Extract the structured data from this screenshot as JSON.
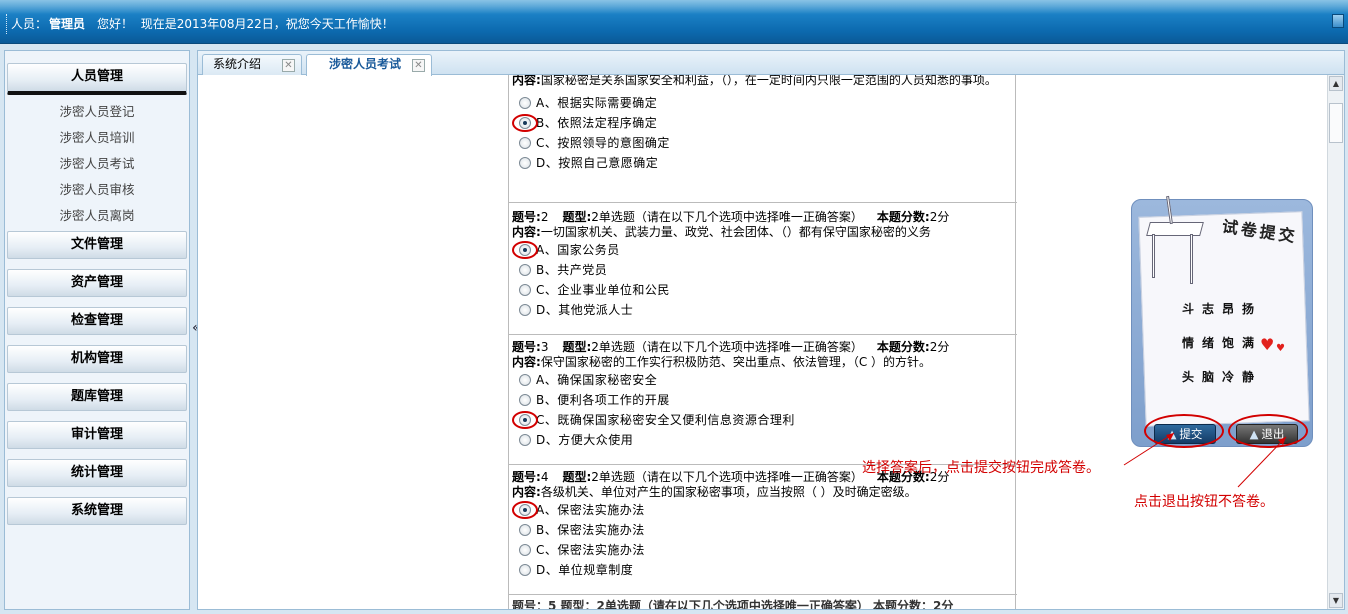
{
  "header": {
    "user_prefix": "人员：",
    "user_name": "管理员",
    "hello": "您好！",
    "date_text": "现在是2013年08月22日，祝您今天工作愉快！"
  },
  "sidebar": {
    "active_menu": "人员管理",
    "sub_items": [
      "涉密人员登记",
      "涉密人员培训",
      "涉密人员考试",
      "涉密人员审核",
      "涉密人员离岗"
    ],
    "menus": [
      "文件管理",
      "资产管理",
      "检查管理",
      "机构管理",
      "题库管理",
      "审计管理",
      "统计管理",
      "系统管理"
    ],
    "collapse_glyph": "«"
  },
  "tabs": [
    {
      "label": "系统介绍",
      "active": false
    },
    {
      "label": "涉密人员考试",
      "active": true
    }
  ],
  "questions": [
    {
      "content_label": "内容:",
      "content": "国家秘密是关系国家安全和利益，（），在一定时间内只限一定范围的人员知悉的事项。",
      "options": [
        "A、根据实际需要确定",
        "B、依照法定程序确定",
        "C、按照领导的意图确定",
        "D、按照自己意愿确定"
      ],
      "selected": 1
    },
    {
      "no_label": "题号:",
      "no": "2",
      "type_label": "题型:",
      "type": "2单选题（请在以下几个选项中选择唯一正确答案）",
      "score_label": "本题分数:",
      "score": "2分",
      "content_label": "内容:",
      "content": "一切国家机关、武装力量、政党、社会团体、（）都有保守国家秘密的义务",
      "options": [
        "A、国家公务员",
        "B、共产党员",
        "C、企业事业单位和公民",
        "D、其他党派人士"
      ],
      "selected": 0
    },
    {
      "no_label": "题号:",
      "no": "3",
      "type_label": "题型:",
      "type": "2单选题（请在以下几个选项中选择唯一正确答案）",
      "score_label": "本题分数:",
      "score": "2分",
      "content_label": "内容:",
      "content": "保守国家秘密的工作实行积极防范、突出重点、依法管理，（C ）的方针。",
      "options": [
        "A、确保国家秘密安全",
        "B、便利各项工作的开展",
        "C、既确保国家秘密安全又便利信息资源合理利",
        "D、方便大众使用"
      ],
      "selected": 2
    },
    {
      "no_label": "题号:",
      "no": "4",
      "type_label": "题型:",
      "type": "2单选题（请在以下几个选项中选择唯一正确答案）",
      "score_label": "本题分数:",
      "score": "2分",
      "content_label": "内容:",
      "content": "各级机关、单位对产生的国家秘密事项，应当按照（ ）及时确定密级。",
      "options": [
        "A、保密法实施办法",
        "B、保密法实施办法",
        "C、保密法实施办法",
        "D、单位规章制度"
      ],
      "selected": 0
    }
  ],
  "cut_header": "题号：5  题型：2单选题（请在以下几个选项中选择唯一正确答案）  本题分数：2分",
  "panel": {
    "title": "试卷提交",
    "motto": [
      "斗志昂扬",
      "情绪饱满",
      "头脑冷静"
    ],
    "submit_label": "提交",
    "exit_label": "退出"
  },
  "annotations": {
    "submit_note": "选择答案后，点击提交按钮完成答卷。",
    "exit_note": "点击退出按钮不答卷。"
  }
}
